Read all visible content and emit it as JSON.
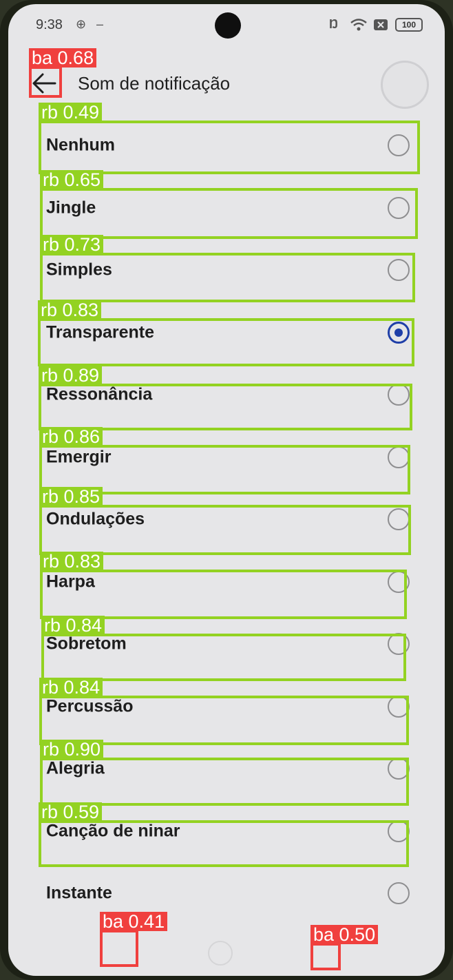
{
  "status_bar": {
    "time": "9:38",
    "icons": [
      "sync-icon",
      "nfc-icon",
      "wifi-icon",
      "sim-icon"
    ],
    "battery": "100"
  },
  "header": {
    "back_icon": "arrow-left-icon",
    "title": "Som de notificação"
  },
  "options": [
    {
      "label": "Nenhum",
      "selected": false
    },
    {
      "label": "Jingle",
      "selected": false
    },
    {
      "label": "Simples",
      "selected": false
    },
    {
      "label": "Transparente",
      "selected": true
    },
    {
      "label": "Ressonância",
      "selected": false
    },
    {
      "label": "Emergir",
      "selected": false
    },
    {
      "label": "Ondulações",
      "selected": false
    },
    {
      "label": "Harpa",
      "selected": false
    },
    {
      "label": "Sobretom",
      "selected": false
    },
    {
      "label": "Percussão",
      "selected": false
    },
    {
      "label": "Alegria",
      "selected": false
    },
    {
      "label": "Canção de ninar",
      "selected": false
    },
    {
      "label": "Instante",
      "selected": false
    }
  ],
  "detections": {
    "back": "ba 0.68",
    "rows": [
      "rb 0.49",
      "rb 0.65",
      "rb 0.73",
      "rb 0.83",
      "rb 0.89",
      "rb 0.86",
      "rb 0.85",
      "rb 0.83",
      "rb 0.84",
      "rb 0.84",
      "rb 0.90",
      "rb 0.59"
    ],
    "nav_left": "ba 0.41",
    "nav_right": "ba 0.50"
  },
  "colors": {
    "accent": "#1f3fa8",
    "row_box": "#93d222",
    "button_box": "#f0403e"
  }
}
